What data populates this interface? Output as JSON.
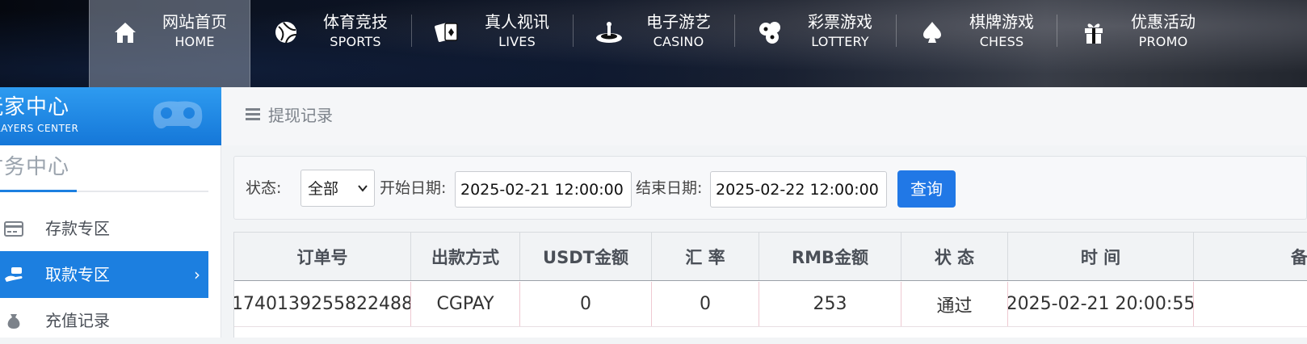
{
  "nav": {
    "items": [
      {
        "cn": "网站首页",
        "en": "HOME",
        "icon": "home-icon",
        "active": true
      },
      {
        "cn": "体育竞技",
        "en": "SPORTS",
        "icon": "sports-ball-icon"
      },
      {
        "cn": "真人视讯",
        "en": "LIVES",
        "icon": "cards-icon"
      },
      {
        "cn": "电子游艺",
        "en": "CASINO",
        "icon": "roulette-icon"
      },
      {
        "cn": "彩票游戏",
        "en": "LOTTERY",
        "icon": "lottery-balls-icon"
      },
      {
        "cn": "棋牌游戏",
        "en": "CHESS",
        "icon": "spade-icon"
      },
      {
        "cn": "优惠活动",
        "en": "PROMO",
        "icon": "gift-icon"
      }
    ]
  },
  "sidebar": {
    "player_center_cn": "玩家中心",
    "player_center_en": "PLAYERS CENTER",
    "section_title": "财务中心",
    "items": [
      {
        "label": "存款专区",
        "icon": "card-icon",
        "active": false
      },
      {
        "label": "取款专区",
        "icon": "withdraw-hand-icon",
        "active": true
      },
      {
        "label": "充值记录",
        "icon": "money-bag-icon",
        "active": false
      }
    ],
    "accent_color": "#1c7fe0"
  },
  "main": {
    "title": "提现记录",
    "filter": {
      "status_label": "状态:",
      "status_value": "全部",
      "start_label": "开始日期:",
      "start_value": "2025-02-21 12:00:00",
      "end_label": "结束日期:",
      "end_value": "2025-02-22 12:00:00",
      "query_label": "查询"
    },
    "table": {
      "headers": [
        "订单号",
        "出款方式",
        "USDT金额",
        "汇 率",
        "RMB金额",
        "状 态",
        "时 间",
        "备"
      ],
      "rows": [
        [
          "1740139255822488",
          "CGPAY",
          "0",
          "0",
          "253",
          "通过",
          "2025-02-21 20:00:55",
          ""
        ]
      ]
    },
    "button_color": "#2178e6"
  }
}
